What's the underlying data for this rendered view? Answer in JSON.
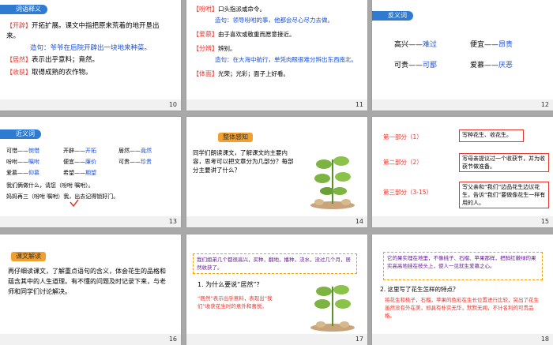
{
  "slide10": {
    "header": "词语释义",
    "rows": [
      {
        "tag": "【开辟】",
        "text": "开拓扩展。课文中指把原来荒着的地开垦出来。"
      },
      {
        "tag": "",
        "text": "造句：爷爷在后院开辟出一块地来种菜。",
        "color": "blue"
      },
      {
        "tag": "【居然】",
        "text": "表示出乎意料；竟然。"
      },
      {
        "tag": "【收获】",
        "text": "取得成熟的农作物。"
      }
    ],
    "page": "10"
  },
  "slide11": {
    "rows": [
      {
        "tag": "【吩咐】",
        "text": "口头指派或命令。"
      },
      {
        "tag": "",
        "text": "造句：领导吩咐的事，他都会尽心尽力去做。",
        "color": "blue"
      },
      {
        "tag": "【爱慕】",
        "text": "由于喜欢或敬重而愿意接近。"
      },
      {
        "tag": "【分辨】",
        "text": "辨别。"
      },
      {
        "tag": "",
        "text": "造句：在大海中航行，单凭肉眼很难分辨出东西南北。",
        "color": "blue"
      },
      {
        "tag": "【体面】",
        "text": "光荣；光彩；面子上好看。"
      }
    ],
    "page": "11"
  },
  "slide12": {
    "header": "反义词",
    "pairs": [
      {
        "a": "高兴——",
        "b": "难过"
      },
      {
        "a": "便宜——",
        "b": "昂贵"
      },
      {
        "a": "可贵——",
        "b": "可鄙"
      },
      {
        "a": "爱慕——",
        "b": "厌恶"
      }
    ],
    "page": "12"
  },
  "slide13": {
    "header": "近义词",
    "grid": [
      [
        "可惜——",
        "惋惜",
        "开辟——",
        "开拓",
        "居然——",
        "竟然"
      ],
      [
        "吩咐——",
        "嘱咐",
        "便宜——",
        "廉价",
        "可贵——",
        "珍贵"
      ],
      [
        "爱慕——",
        "仰慕",
        "希望——",
        "期望",
        "",
        ""
      ]
    ],
    "line1": "我们俩做什么，请您（吩咐  嘱咐）。",
    "line2": "妈妈再三（吩咐  嘱咐）我，出去记得锁好门。",
    "page": "13"
  },
  "slide14": {
    "header": "整体感知",
    "text": "同学们朗读课文，了解课文的主要内容，思考可以把文章分为几部分？每部分主要讲了什么？",
    "page": "14"
  },
  "slide15": {
    "parts": [
      {
        "label": "第一部分（1）",
        "desc": "写种花生、收花生。"
      },
      {
        "label": "第二部分（2）",
        "desc": "写母亲提议过一个收获节，并为收获节做准备。"
      },
      {
        "label": "第三部分（3-15）",
        "desc": "写父亲和“我们”边品花生边议花生，告诉“我们”要做像花生一样有用的人。"
      }
    ],
    "page": "15"
  },
  "slide16": {
    "header": "课文解读",
    "text": "再仔细读课文，了解重点语句的含义，体会花生的品格和蕴含其中的人生道理。有不懂的问题及时记录下来，与老师和同学们讨论解决。",
    "page": "16"
  },
  "slide17": {
    "quote": "我们姐弟几个都很高兴，买种，翻地，播种，浇水，没过几个月，居然收获了。",
    "question": "1. 为什么要说“居然”？",
    "answer": "“居然”表示出乎意料，表现出“我们”收获花生时的意外和喜悦。",
    "page": "17"
  },
  "slide18": {
    "quote": "它的果实埋在地里，不像桃子、石榴、苹果那样，把鲜红嫩绿的果实高高地挂在枝头上，使人一见就生爱慕之心。",
    "question": "2. 这里写了花生怎样的特点？",
    "answer": "将花生和桃子，石榴，苹果的色彩在生长位置进行比较，突出了花生虽然没有外在美，却具有朴实无华，默默无闻，不计名利的可贵品格。",
    "page": "18"
  }
}
